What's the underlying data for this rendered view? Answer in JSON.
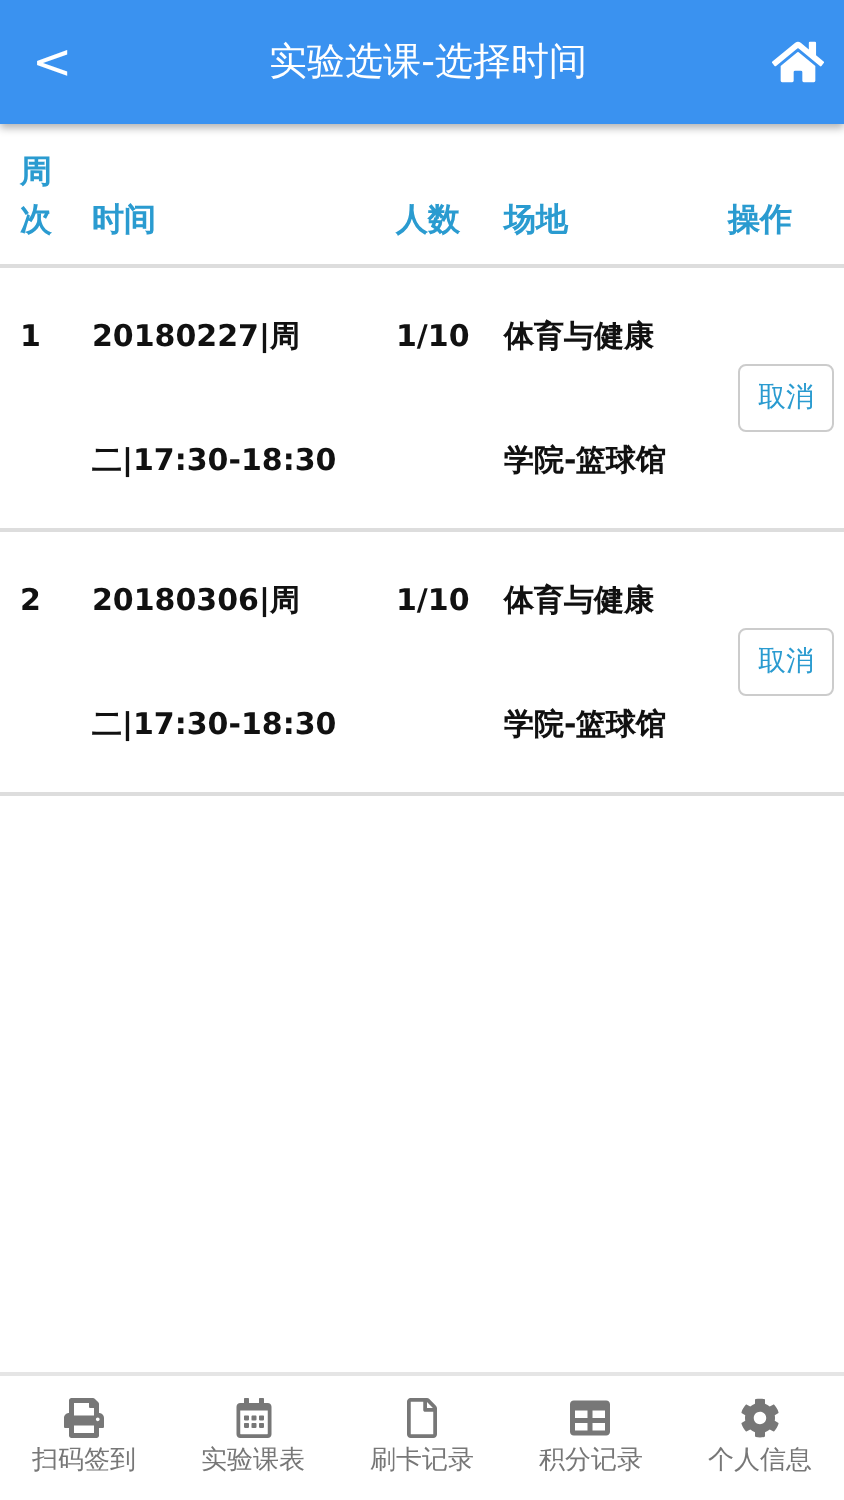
{
  "header": {
    "back": "<",
    "title": "实验选课-选择时间"
  },
  "table": {
    "columns": [
      "周次",
      "时间",
      "人数",
      "场地",
      "操作"
    ],
    "rows": [
      {
        "week": "1",
        "time_lines": [
          "20180227|周",
          "二|17:30-18:30"
        ],
        "count": "1/10",
        "venue_lines": [
          "体育与健康",
          "学院-篮球馆"
        ],
        "action": "取消"
      },
      {
        "week": "2",
        "time_lines": [
          "20180306|周",
          "二|17:30-18:30"
        ],
        "count": "1/10",
        "venue_lines": [
          "体育与健康",
          "学院-篮球馆"
        ],
        "action": "取消"
      }
    ]
  },
  "nav": [
    {
      "kind": "printer",
      "label": "扫码签到"
    },
    {
      "kind": "calendar",
      "label": "实验课表"
    },
    {
      "kind": "file",
      "label": "刷卡记录"
    },
    {
      "kind": "grid",
      "label": "积分记录"
    },
    {
      "kind": "gear",
      "label": "个人信息"
    }
  ]
}
